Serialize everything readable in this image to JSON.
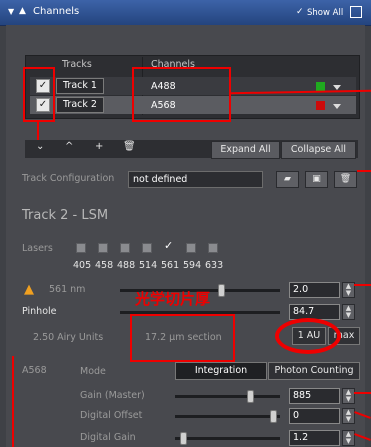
{
  "window": {
    "title": "Channels",
    "show_all": "Show All"
  },
  "tracks": {
    "col_tracks": "Tracks",
    "col_channels": "Channels",
    "rows": [
      {
        "name": "Track 1",
        "channel": "A488",
        "color": "#1faa1f"
      },
      {
        "name": "Track 2",
        "channel": "A568",
        "color": "#cc0b0b"
      }
    ]
  },
  "toolbar": {
    "expand_all": "Expand All",
    "collapse_all": "Collapse All"
  },
  "track_config": {
    "label": "Track Configuration",
    "value": "not defined"
  },
  "section_title": "Track 2 - LSM",
  "lasers": {
    "label": "Lasers",
    "lines": [
      {
        "wl": "405",
        "checked": false
      },
      {
        "wl": "458",
        "checked": false
      },
      {
        "wl": "488",
        "checked": false
      },
      {
        "wl": "514",
        "checked": false
      },
      {
        "wl": "561",
        "checked": true
      },
      {
        "wl": "594",
        "checked": false
      },
      {
        "wl": "633",
        "checked": false
      }
    ]
  },
  "laser_power": {
    "label": "561 nm",
    "value": "2.0"
  },
  "pinhole": {
    "label": "Pinhole",
    "value": "84.7"
  },
  "airy": {
    "units": "2.50 Airy Units",
    "section": "17.2 µm section",
    "btn_1au": "1 AU",
    "btn_max": "max"
  },
  "annotation": {
    "text": "光学切片厚"
  },
  "detector": {
    "channel": "A568",
    "mode_label": "Mode",
    "mode_integration": "Integration",
    "mode_photon": "Photon Counting",
    "gain_label": "Gain (Master)",
    "gain_value": "885",
    "offset_label": "Digital Offset",
    "offset_value": "0",
    "dgain_label": "Digital Gain",
    "dgain_value": "1.2"
  },
  "accent_colors": {
    "title_bar": "#2f559a",
    "annotation": "#ee0000"
  }
}
